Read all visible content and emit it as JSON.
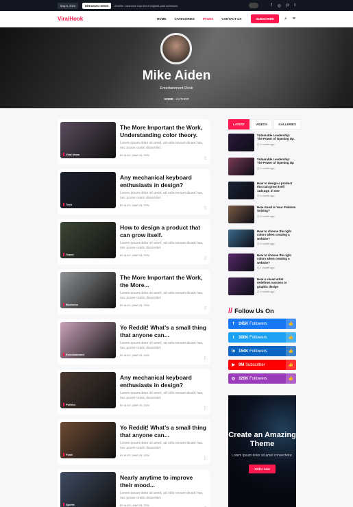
{
  "topbar": {
    "date": "May 6, 2024",
    "breaking_label": "BREAKING NEWS",
    "breaking_text": "Jennifer Lawrence tops list of highest-paid actresses",
    "social_icons": [
      "facebook-icon",
      "instagram-icon",
      "pinterest-icon",
      "twitter-icon"
    ]
  },
  "header": {
    "logo": "ViralHook",
    "menu": [
      "HOME",
      "CATEGORIES",
      "PAGES",
      "CONTACT US"
    ],
    "subscribe": "SUBSCRIBE"
  },
  "hero": {
    "name": "Mike Aiden",
    "subtitle": "Entertainment Desk",
    "crumb_home": "HOME",
    "crumb_current": "AUTHOR"
  },
  "posts": [
    {
      "title": "The More Important the Work, Understanding color theory.",
      "excerpt": "Lorem ipsum dolor sit amet, ad odio novum dicant has, nec posse oratio dissentiet.",
      "category": "Viral News",
      "meta": "BY ALEX  |  MAR 25, 2024",
      "color": "#5a4b5e"
    },
    {
      "title": "Any mechanical keyboard enthusiasts in design?",
      "excerpt": "Lorem ipsum dolor sit amet, ad odio novum dicant has, nec posse oratio dissentiet.",
      "category": "Tech",
      "meta": "BY ALEX  |  MAR 25, 2024",
      "color": "#1d2130"
    },
    {
      "title": "How to design a product that can grow itself.",
      "excerpt": "Lorem ipsum dolor sit amet, ad odio novum dicant has, nec posse oratio dissentiet.",
      "category": "Travel",
      "meta": "BY ALEX  |  MAR 25, 2024",
      "color": "#3d4736"
    },
    {
      "title": "The More Important the Work, the More...",
      "excerpt": "Lorem ipsum dolor sit amet, ad odio novum dicant has, nec posse oratio dissentiet.",
      "category": "Business",
      "meta": "BY ALEX  |  MAR 25, 2024",
      "color": "#8f9397"
    },
    {
      "title": "Yo Reddit! What’s a small thing that anyone can...",
      "excerpt": "Lorem ipsum dolor sit amet, ad odio novum dicant has, nec posse oratio dissentiet.",
      "category": "Entertainment",
      "meta": "BY ALEX  |  MAR 25, 2024",
      "color": "#c9a2ba"
    },
    {
      "title": "Any mechanical keyboard enthusiasts in design?",
      "excerpt": "Lorem ipsum dolor sit amet, ad odio novum dicant has, nec posse oratio dissentiet.",
      "category": "Politics",
      "meta": "BY ALEX  |  MAR 25, 2024",
      "color": "#4a3a32"
    },
    {
      "title": "Yo Reddit! What’s a small thing that anyone can...",
      "excerpt": "Lorem ipsum dolor sit amet, ad odio novum dicant has, nec posse oratio dissentiet.",
      "category": "Food",
      "meta": "BY ALEX  |  MAR 25, 2024",
      "color": "#6b4a33"
    },
    {
      "title": "Nearly anytime to improve their mood...",
      "excerpt": "Lorem ipsum dolor sit amet, ad odio novum dicant has, nec posse oratio dissentiet.",
      "category": "Sports",
      "meta": "BY ALEX  |  MAR 25, 2024",
      "color": "#3f4c63"
    }
  ],
  "sidebar": {
    "tabs": [
      "LATEST",
      "VIDEOS",
      "GALLERIES"
    ],
    "latest": [
      {
        "title": "Vulnerable Leadership: The Power of Opening Up",
        "time": "1 month ago",
        "color": "#2b1a3a"
      },
      {
        "title": "Vulnerable Leadership: The Power of Opening Up",
        "time": "1 month ago",
        "color": "#7a3a55"
      },
      {
        "title": "How to design a product that can grow itself 1&lt;&gt; in one",
        "time": "1 month ago",
        "color": "#1a2233"
      },
      {
        "title": "How Good Is Your Problem Solving?",
        "time": "1 month ago",
        "color": "#7a5a44"
      },
      {
        "title": "How to choose the right colors when creating a website?",
        "time": "1 month ago",
        "color": "#3a6a8a"
      },
      {
        "title": "How to choose the right colors when creating a website?",
        "time": "1 month ago",
        "color": "#5a2a6a"
      },
      {
        "title": "How a visual artist redefines success in graphic design",
        "time": "1 month ago",
        "color": "#4a2a5a"
      }
    ],
    "follow_heading": "Follow Us On",
    "socials": [
      {
        "icon": "f",
        "count": "245K",
        "label": "Followers",
        "color": "#1877f2"
      },
      {
        "icon": "t",
        "count": "300K",
        "label": "Followers",
        "color": "#1da1f2"
      },
      {
        "icon": "in",
        "count": "154K",
        "label": "Followers",
        "color": "#0a66c2"
      },
      {
        "icon": "▶",
        "count": "9M",
        "label": "Subscriber",
        "color": "#ff0000"
      },
      {
        "icon": "◎",
        "count": "320K",
        "label": "Followers",
        "color": "#9b3dbb"
      }
    ],
    "promo_title": "Create an Amazing Theme",
    "promo_sub": "Lorem ipsum dolor sit amet consectetur.",
    "promo_button": "Order now"
  }
}
